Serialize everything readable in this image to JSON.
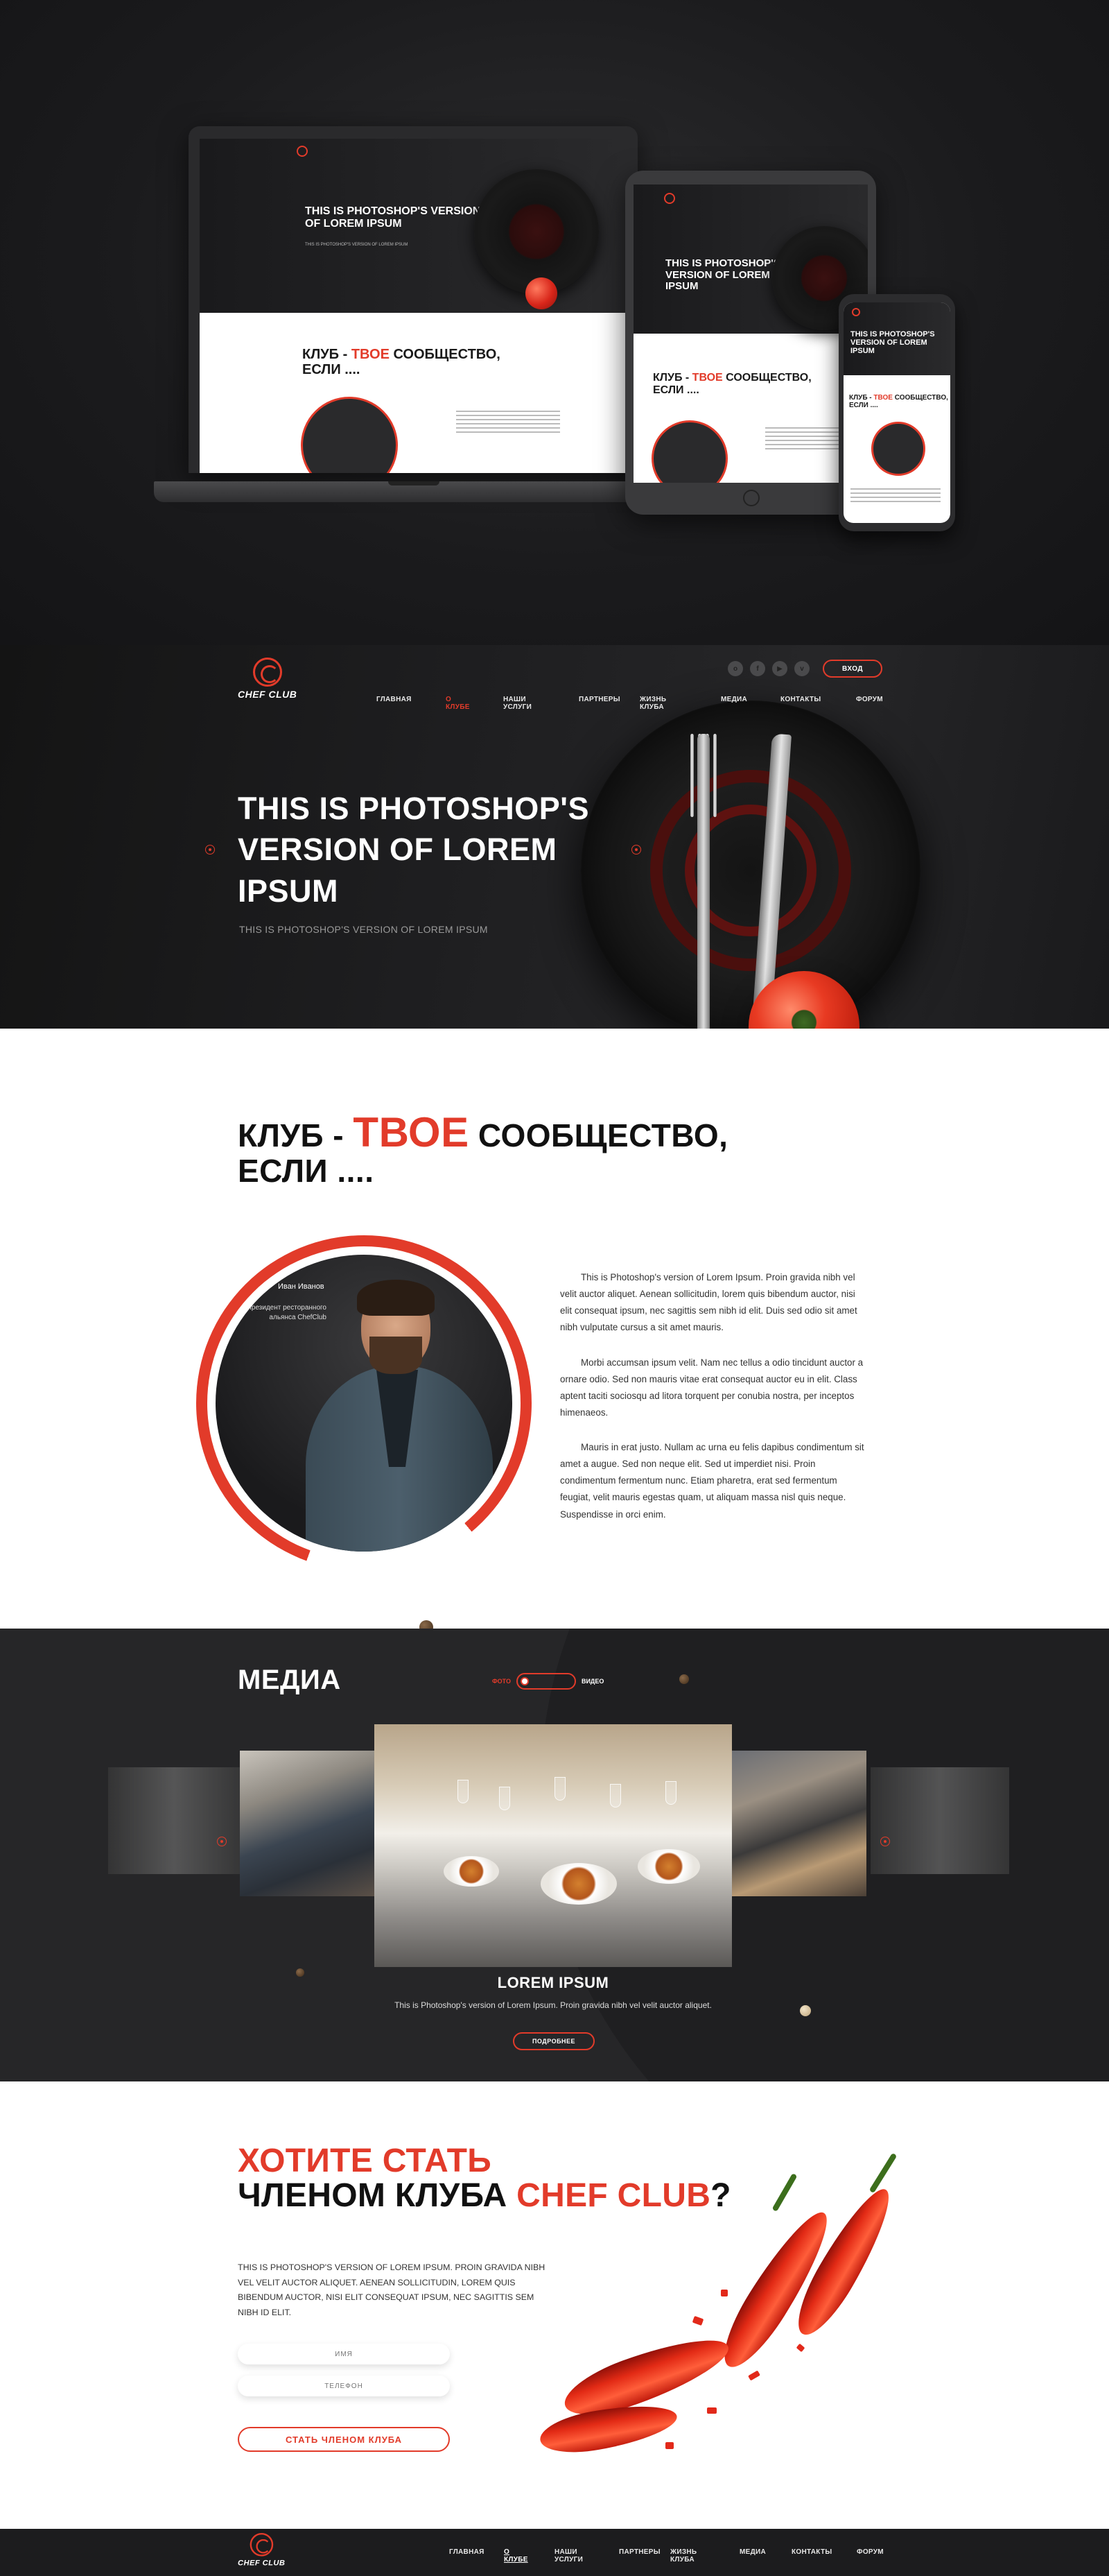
{
  "brand": {
    "name": "CHEF CLUB",
    "accent": "#e23b2a",
    "dark": "#1c1c1e"
  },
  "nav": {
    "items": [
      "ГЛАВНАЯ",
      "О КЛУБЕ",
      "НАШИ УСЛУГИ",
      "ПАРТНЕРЫ",
      "ЖИЗНЬ КЛУБА",
      "МЕДИА",
      "КОНТАКТЫ",
      "ФОРУМ"
    ],
    "active_index": 1,
    "login": "ВХОД",
    "social_icons": [
      "odnoklassniki-icon",
      "facebook-icon",
      "youtube-icon",
      "vk-icon"
    ]
  },
  "hero": {
    "title_lines": [
      "THIS IS PHOTOSHOP'S",
      "VERSION OF LOREM",
      "IPSUM"
    ],
    "subtitle": "THIS IS PHOTOSHOP'S VERSION OF LOREM IPSUM"
  },
  "mockup": {
    "title_short": "THIS IS PHOTOSHOP'S VERSION OF LOREM IPSUM",
    "subtitle_short": "THIS IS PHOTOSHOP'S VERSION OF LOREM IPSUM",
    "club_a": "КЛУБ - ",
    "club_b": "ТВОЕ",
    "club_c": " СООБЩЕСТВО,",
    "club_d": "ЕСЛИ ...."
  },
  "about": {
    "title_prefix": "КЛУБ - ",
    "title_highlight": "ТВОЕ",
    "title_suffix": " СООБЩЕСТВО,",
    "title_line2": "ЕСЛИ ....",
    "person_name": "Иван Иванов",
    "person_role": "Президент ресторанного альянса ChefClub",
    "paragraphs": [
      "This is Photoshop's version  of Lorem Ipsum. Proin gravida nibh vel velit auctor aliquet. Aenean sollicitudin, lorem quis bibendum auctor, nisi elit consequat ipsum, nec sagittis sem nibh id elit. Duis sed odio sit amet nibh vulputate cursus a sit amet mauris.",
      "Morbi accumsan ipsum velit. Nam nec tellus a odio tincidunt auctor a ornare odio. Sed non  mauris vitae erat consequat auctor eu in elit. Class aptent taciti sociosqu ad litora torquent per conubia nostra, per inceptos himenaeos.",
      "Mauris in erat justo. Nullam ac urna eu felis dapibus condimentum sit amet a augue. Sed non neque elit. Sed ut imperdiet nisi. Proin condimentum fermentum nunc. Etiam pharetra, erat sed fermentum feugiat, velit mauris egestas quam, ut aliquam massa nisl quis neque. Suspendisse in orci enim."
    ]
  },
  "media": {
    "title": "МЕДИА",
    "toggle_left": "ФОТО",
    "toggle_right": "ВИДЕО",
    "caption_title": "LOREM IPSUM",
    "caption_text": "This is Photoshop's version  of Lorem Ipsum. Proin gravida nibh vel velit auctor aliquet.",
    "more": "ПОДРОБНЕЕ"
  },
  "join": {
    "title_line1": "ХОТИТЕ СТАТЬ",
    "title_line2_a": "ЧЛЕНОМ КЛУБА ",
    "title_line2_b": "CHEF CLUB",
    "title_line2_c": "?",
    "text": "THIS IS PHOTOSHOP'S VERSION  OF LOREM IPSUM. PROIN GRAVIDA NIBH VEL VELIT AUCTOR ALIQUET. AENEAN SOLLICITUDIN, LOREM QUIS BIBENDUM AUCTOR, NISI ELIT CONSEQUAT IPSUM, NEC SAGITTIS SEM NIBH ID ELIT.",
    "name_placeholder": "ИМЯ",
    "phone_placeholder": "ТЕЛЕФОН",
    "submit": "СТАТЬ ЧЛЕНОМ КЛУБА"
  }
}
